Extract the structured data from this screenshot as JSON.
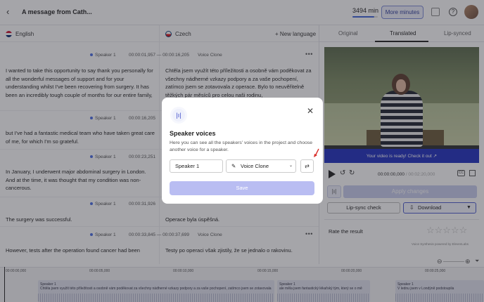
{
  "header": {
    "title": "A message from Cath...",
    "minutes": "3494 min",
    "minutes_fraction": 0.85,
    "more_minutes_label": "More minutes",
    "help_label": "?"
  },
  "editor": {
    "source_language": "English",
    "target_language": "Czech",
    "new_language_label": "New language",
    "segments": [
      {
        "speaker": "Speaker 1",
        "timecode": "00:00:01,957 — 00:00:16,205",
        "voice": "Voice Clone",
        "source": "I wanted to take this opportunity to say thank you personally for all the wonderful messages of support and for your understanding whilst I've been recovering from surgery. It has been an incredibly tough couple of months for our entire family,",
        "target": "Chtěla jsem využít této příležitosti a osobně vám poděkovat za všechny nádherné vzkazy podpory a za vaše pochopení, zatímco jsem se zotavovala z operace. Bylo to neuvěřitelně těžkých pár měsíců pro celou naši rodinu,"
      },
      {
        "speaker": "Speaker 1",
        "timecode": "00:00:16,205",
        "voice": "",
        "source": "but I've had a fantastic medical team who have taken great care of me, for which I'm so grateful.",
        "target": ""
      },
      {
        "speaker": "Speaker 1",
        "timecode": "00:00:23,251",
        "voice": "",
        "source": "In January, I underwent major abdominal surgery in London. And at the time, it was thought that my condition was non-cancerous.",
        "target": ""
      },
      {
        "speaker": "Speaker 1",
        "timecode": "00:00:31,926",
        "voice": "",
        "source": "The surgery was successful.",
        "target": "Operace byla úspěšná."
      },
      {
        "speaker": "Speaker 1",
        "timecode": "00:00:33,845 — 00:00:37,699",
        "voice": "Voice Clone",
        "source": "However, tests after the operation found cancer had been",
        "target": "Testy po operaci však zjistily, že se jednalo o rakovinu."
      }
    ]
  },
  "right_panel": {
    "tabs": [
      "Original",
      "Translated",
      "Lip-synced"
    ],
    "video_banner": "Your video is ready! Check it out ↗",
    "time_current": "00:00:00,000",
    "time_total": "/ 00:02:20,000",
    "cc_label": "CC",
    "apply_label": "Apply changes",
    "lipsync_label": "Lip-sync check",
    "download_label": "Download",
    "rate_label": "Rate the result",
    "credit": "Voice Synthesis powered by ElevenLabs"
  },
  "timeline": {
    "ticks": [
      "00:00:00,000",
      "00:00:05,000",
      "00:00:10,000",
      "00:00:15,000",
      "00:00:20,000",
      "00:00:25,000"
    ],
    "clips": [
      {
        "speaker": "Speaker 1",
        "text": "Chtěla jsem využít této příležitosti a osobně vám poděkovat za všechny nádherné vzkazy podpory a za vaše pochopení, zatímco jsem se zotavovala"
      },
      {
        "speaker": "Speaker 1",
        "text": "ale měla jsem fantastický lékařský tým, který se o mě"
      },
      {
        "speaker": "Speaker 1",
        "text": "V lednu jsem v Londýně podstoupila"
      }
    ]
  },
  "modal": {
    "title": "Speaker voices",
    "description": "Here you can see all the speakers' voices in the project and choose another voice for a speaker.",
    "speaker_value": "Speaker 1",
    "voice_value": "Voice Clone",
    "save_label": "Save"
  },
  "colors": {
    "accent": "#3b49c9",
    "banner": "#1f2fbf",
    "save_disabled": "#b9bdf2"
  }
}
